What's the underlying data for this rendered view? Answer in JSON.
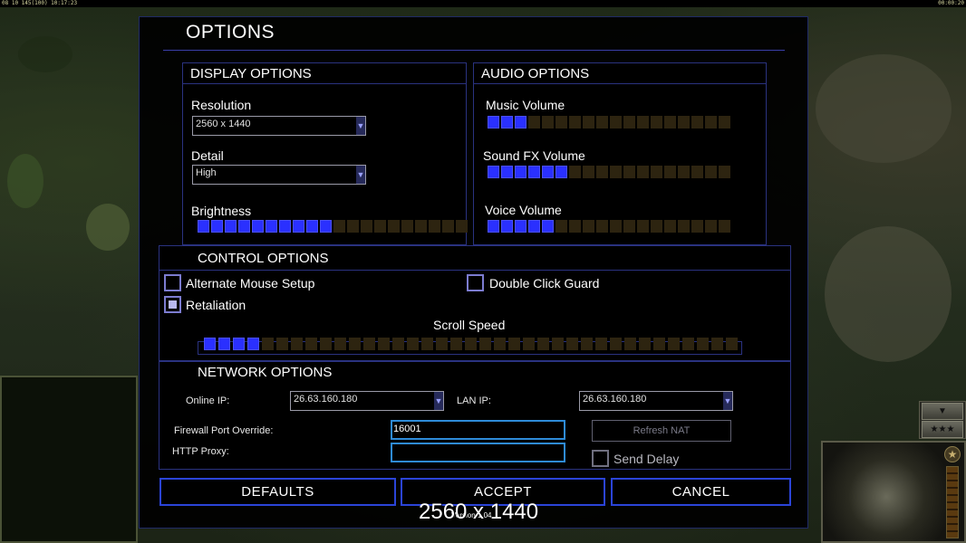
{
  "topbar": {
    "left_text": "08 10 145(100) 10:17:23",
    "right_text": "00:00:20"
  },
  "hud": {
    "arrow_down": "▼",
    "stars": "★★★",
    "emblem": "★"
  },
  "dialog": {
    "title": "OPTIONS",
    "display": {
      "header": "DISPLAY OPTIONS",
      "resolution_label": "Resolution",
      "resolution_value": "2560 x 1440",
      "detail_label": "Detail",
      "detail_value": "High",
      "brightness_label": "Brightness",
      "brightness_level": 10,
      "brightness_total": 20
    },
    "audio": {
      "header": "AUDIO OPTIONS",
      "music_label": "Music Volume",
      "music_level": 3,
      "sfx_label": "Sound FX Volume",
      "sfx_level": 6,
      "voice_label": "Voice Volume",
      "voice_level": 5,
      "total": 18
    },
    "control": {
      "header": "CONTROL OPTIONS",
      "alt_mouse_label": "Alternate Mouse Setup",
      "alt_mouse_checked": false,
      "double_click_label": "Double Click Guard",
      "double_click_checked": false,
      "retaliation_label": "Retaliation",
      "retaliation_checked": true,
      "scroll_label": "Scroll Speed",
      "scroll_level": 4,
      "scroll_total": 37
    },
    "network": {
      "header": "NETWORK OPTIONS",
      "online_ip_label": "Online IP:",
      "online_ip_value": "26.63.160.180",
      "lan_ip_label": "LAN IP:",
      "lan_ip_value": "26.63.160.180",
      "firewall_label": "Firewall Port Override:",
      "firewall_value": "16001",
      "proxy_label": "HTTP Proxy:",
      "proxy_value": "",
      "refresh_nat_label": "Refresh NAT",
      "send_delay_label": "Send Delay",
      "send_delay_checked": false
    },
    "buttons": {
      "defaults": "DEFAULTS",
      "accept": "ACCEPT",
      "cancel": "CANCEL"
    },
    "version": "Version 1.04"
  },
  "overlay_resolution": "2560 x 1440",
  "colors": {
    "slider_on": "#2a30ff",
    "slider_off": "#2d2410",
    "panel_border": "#2a3280",
    "button_border": "#2b44d8",
    "textbox_border": "#2e8bd8"
  }
}
